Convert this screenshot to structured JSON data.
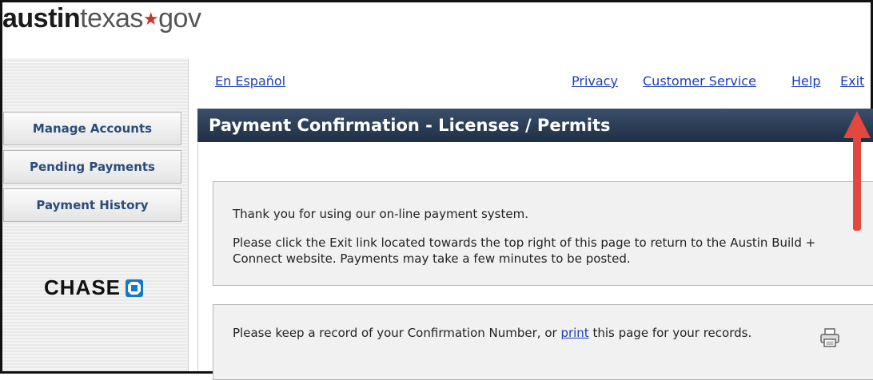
{
  "logo": {
    "bold": "austin",
    "light": "texas",
    "star": "★",
    "suffix": "gov"
  },
  "top_links": {
    "espanol": "En Español",
    "privacy": "Privacy",
    "customer_service": "Customer Service",
    "help": "Help",
    "exit": "Exit"
  },
  "sidebar": {
    "items": [
      {
        "label": "Manage Accounts"
      },
      {
        "label": "Pending Payments"
      },
      {
        "label": "Payment History"
      }
    ],
    "brand": "CHASE"
  },
  "header": {
    "title": "Payment Confirmation - Licenses / Permits"
  },
  "message_box": {
    "line1": "Thank you for using our on-line payment system.",
    "line2": "Please click the Exit link located towards the top right of this page to return to the Austin Build + Connect website. Payments may take a few minutes to be posted."
  },
  "record_box": {
    "before": "Please keep a record of your Confirmation Number, or ",
    "link": "print",
    "after": " this page for your records."
  },
  "colors": {
    "header_bg": "#2c3e57",
    "link": "#1c3db5",
    "nav_text": "#2b4c7a",
    "arrow": "#e2483d",
    "chase_blue": "#117aca"
  }
}
